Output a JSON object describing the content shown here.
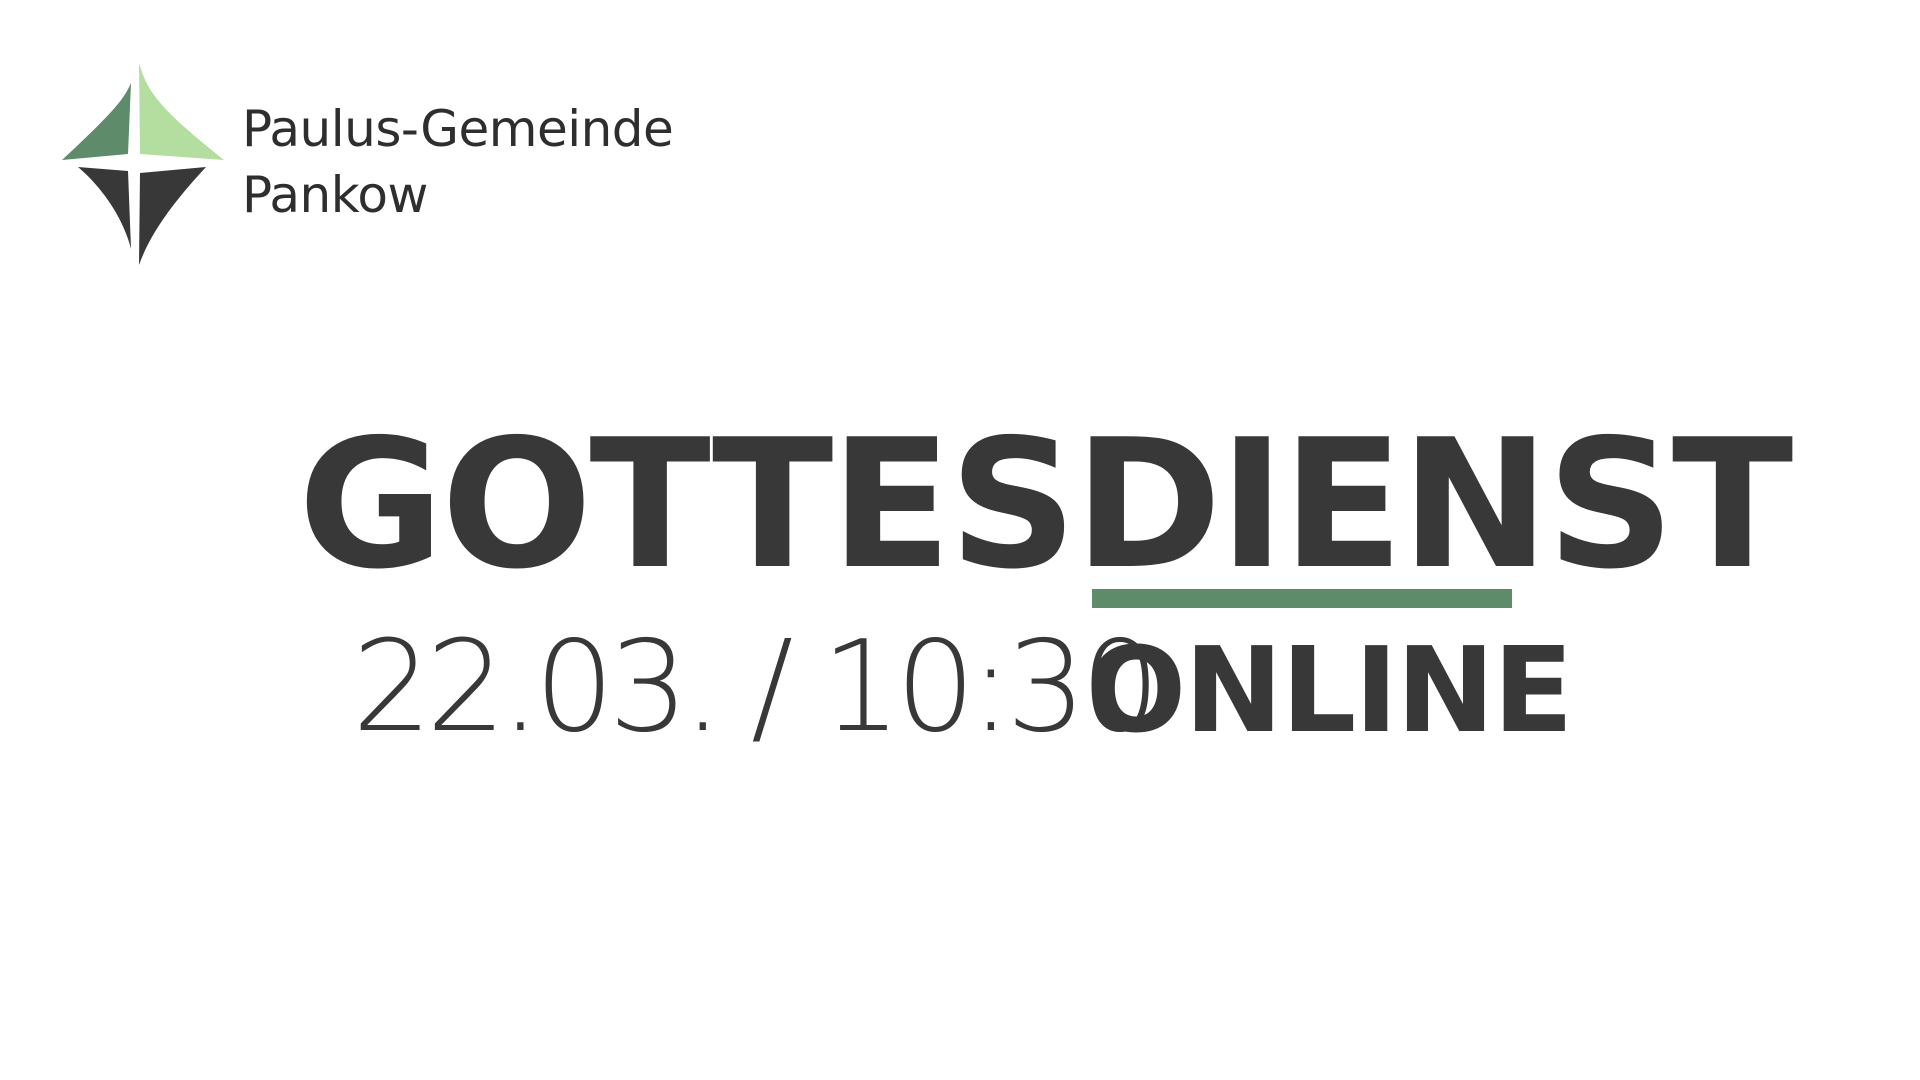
{
  "organization": {
    "line1": "Paulus-Gemeinde",
    "line2": "Pankow",
    "logo_icon": "four-point-star-logo-icon",
    "logo_colors": {
      "dark_green": "#5e8b6a",
      "light_green": "#b4dea0",
      "dark_gray": "#383838"
    }
  },
  "event": {
    "title": "GOTTESDIENST",
    "datetime": "22.03. / 10:30",
    "mode": "ONLINE"
  },
  "colors": {
    "text": "#383838",
    "accent": "#5e8b6a",
    "background": "#ffffff"
  }
}
